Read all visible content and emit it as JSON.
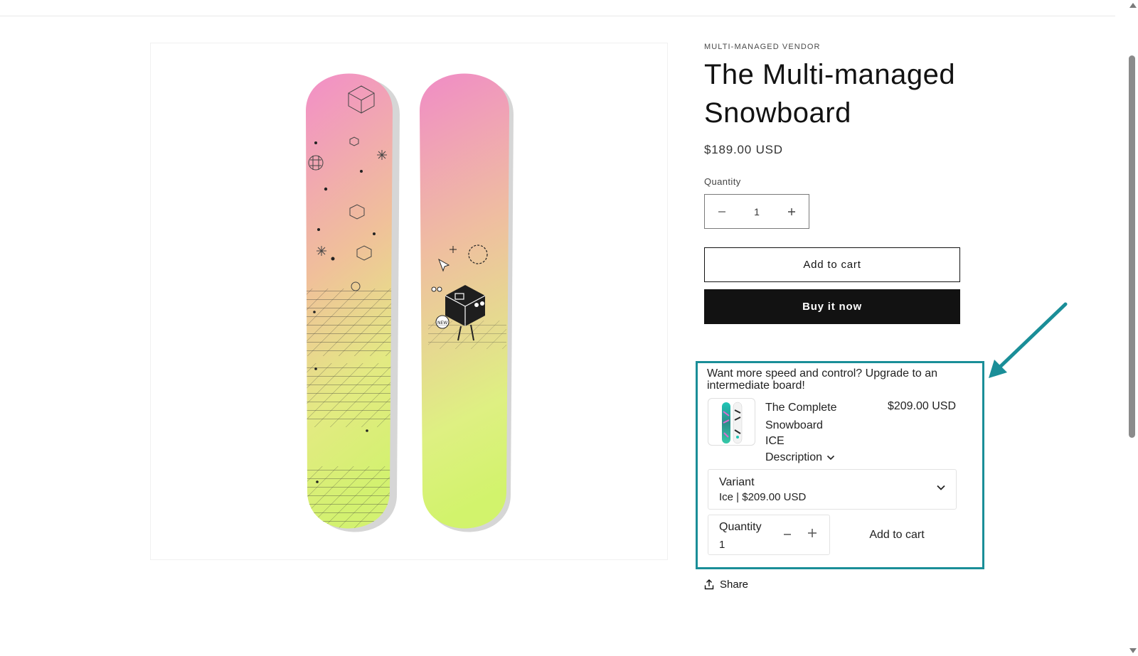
{
  "product": {
    "vendor": "MULTI-MANAGED VENDOR",
    "title": "The Multi-managed Snowboard",
    "price": "$189.00 USD",
    "quantity_label": "Quantity",
    "quantity_value": "1",
    "add_to_cart": "Add to cart",
    "buy_now": "Buy it now",
    "share": "Share"
  },
  "upsell": {
    "headline": "Want more speed and control? Upgrade to an intermediate board!",
    "product_name": "The Complete Snowboard",
    "product_price": "$209.00 USD",
    "variant_name": "ICE",
    "description_label": "Description",
    "variant_select_label": "Variant",
    "variant_select_value": "Ice | $209.00 USD",
    "quantity_label": "Quantity",
    "quantity_value": "1",
    "add_to_cart": "Add to cart"
  },
  "colors": {
    "highlight": "#1a8e98",
    "primary_button": "#121212",
    "board_pink": "#f29ac4",
    "board_lime": "#d6f07a"
  },
  "icons": [
    "minus-icon",
    "plus-icon",
    "chevron-down-icon",
    "share-icon",
    "callout-arrow-icon"
  ]
}
